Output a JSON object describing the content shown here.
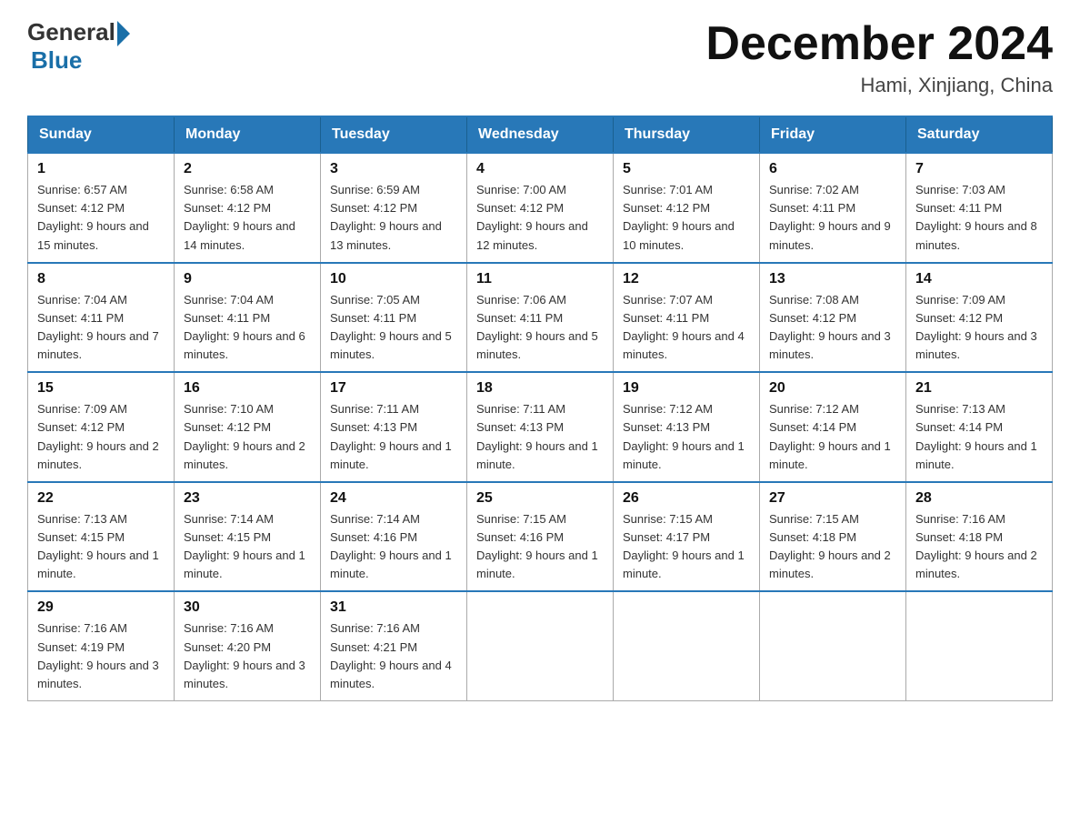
{
  "logo": {
    "general": "General",
    "blue": "Blue"
  },
  "title": "December 2024",
  "location": "Hami, Xinjiang, China",
  "days_of_week": [
    "Sunday",
    "Monday",
    "Tuesday",
    "Wednesday",
    "Thursday",
    "Friday",
    "Saturday"
  ],
  "weeks": [
    [
      {
        "day": "1",
        "sunrise": "6:57 AM",
        "sunset": "4:12 PM",
        "daylight": "9 hours and 15 minutes."
      },
      {
        "day": "2",
        "sunrise": "6:58 AM",
        "sunset": "4:12 PM",
        "daylight": "9 hours and 14 minutes."
      },
      {
        "day": "3",
        "sunrise": "6:59 AM",
        "sunset": "4:12 PM",
        "daylight": "9 hours and 13 minutes."
      },
      {
        "day": "4",
        "sunrise": "7:00 AM",
        "sunset": "4:12 PM",
        "daylight": "9 hours and 12 minutes."
      },
      {
        "day": "5",
        "sunrise": "7:01 AM",
        "sunset": "4:12 PM",
        "daylight": "9 hours and 10 minutes."
      },
      {
        "day": "6",
        "sunrise": "7:02 AM",
        "sunset": "4:11 PM",
        "daylight": "9 hours and 9 minutes."
      },
      {
        "day": "7",
        "sunrise": "7:03 AM",
        "sunset": "4:11 PM",
        "daylight": "9 hours and 8 minutes."
      }
    ],
    [
      {
        "day": "8",
        "sunrise": "7:04 AM",
        "sunset": "4:11 PM",
        "daylight": "9 hours and 7 minutes."
      },
      {
        "day": "9",
        "sunrise": "7:04 AM",
        "sunset": "4:11 PM",
        "daylight": "9 hours and 6 minutes."
      },
      {
        "day": "10",
        "sunrise": "7:05 AM",
        "sunset": "4:11 PM",
        "daylight": "9 hours and 5 minutes."
      },
      {
        "day": "11",
        "sunrise": "7:06 AM",
        "sunset": "4:11 PM",
        "daylight": "9 hours and 5 minutes."
      },
      {
        "day": "12",
        "sunrise": "7:07 AM",
        "sunset": "4:11 PM",
        "daylight": "9 hours and 4 minutes."
      },
      {
        "day": "13",
        "sunrise": "7:08 AM",
        "sunset": "4:12 PM",
        "daylight": "9 hours and 3 minutes."
      },
      {
        "day": "14",
        "sunrise": "7:09 AM",
        "sunset": "4:12 PM",
        "daylight": "9 hours and 3 minutes."
      }
    ],
    [
      {
        "day": "15",
        "sunrise": "7:09 AM",
        "sunset": "4:12 PM",
        "daylight": "9 hours and 2 minutes."
      },
      {
        "day": "16",
        "sunrise": "7:10 AM",
        "sunset": "4:12 PM",
        "daylight": "9 hours and 2 minutes."
      },
      {
        "day": "17",
        "sunrise": "7:11 AM",
        "sunset": "4:13 PM",
        "daylight": "9 hours and 1 minute."
      },
      {
        "day": "18",
        "sunrise": "7:11 AM",
        "sunset": "4:13 PM",
        "daylight": "9 hours and 1 minute."
      },
      {
        "day": "19",
        "sunrise": "7:12 AM",
        "sunset": "4:13 PM",
        "daylight": "9 hours and 1 minute."
      },
      {
        "day": "20",
        "sunrise": "7:12 AM",
        "sunset": "4:14 PM",
        "daylight": "9 hours and 1 minute."
      },
      {
        "day": "21",
        "sunrise": "7:13 AM",
        "sunset": "4:14 PM",
        "daylight": "9 hours and 1 minute."
      }
    ],
    [
      {
        "day": "22",
        "sunrise": "7:13 AM",
        "sunset": "4:15 PM",
        "daylight": "9 hours and 1 minute."
      },
      {
        "day": "23",
        "sunrise": "7:14 AM",
        "sunset": "4:15 PM",
        "daylight": "9 hours and 1 minute."
      },
      {
        "day": "24",
        "sunrise": "7:14 AM",
        "sunset": "4:16 PM",
        "daylight": "9 hours and 1 minute."
      },
      {
        "day": "25",
        "sunrise": "7:15 AM",
        "sunset": "4:16 PM",
        "daylight": "9 hours and 1 minute."
      },
      {
        "day": "26",
        "sunrise": "7:15 AM",
        "sunset": "4:17 PM",
        "daylight": "9 hours and 1 minute."
      },
      {
        "day": "27",
        "sunrise": "7:15 AM",
        "sunset": "4:18 PM",
        "daylight": "9 hours and 2 minutes."
      },
      {
        "day": "28",
        "sunrise": "7:16 AM",
        "sunset": "4:18 PM",
        "daylight": "9 hours and 2 minutes."
      }
    ],
    [
      {
        "day": "29",
        "sunrise": "7:16 AM",
        "sunset": "4:19 PM",
        "daylight": "9 hours and 3 minutes."
      },
      {
        "day": "30",
        "sunrise": "7:16 AM",
        "sunset": "4:20 PM",
        "daylight": "9 hours and 3 minutes."
      },
      {
        "day": "31",
        "sunrise": "7:16 AM",
        "sunset": "4:21 PM",
        "daylight": "9 hours and 4 minutes."
      },
      null,
      null,
      null,
      null
    ]
  ]
}
